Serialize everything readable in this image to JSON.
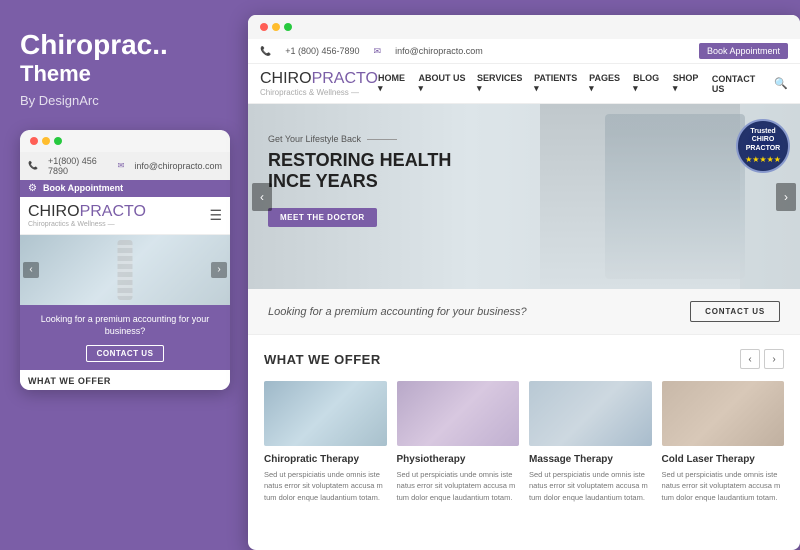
{
  "theme": {
    "title": "Chiroprac..",
    "subtitle": "Theme",
    "author": "By DesignArc"
  },
  "mobile": {
    "top_bar_dots": [
      "red",
      "yellow",
      "green"
    ],
    "info_bar": {
      "phone": "+1(800) 456 7890",
      "email": "info@chiropracto.com"
    },
    "book_btn": "Book Appointment",
    "logo": {
      "chiro": "CHIRO",
      "practo": "PRACTO",
      "sub": "Chiropractics & Wellness —"
    },
    "promo": {
      "text": "Looking for a premium accounting for your business?",
      "btn": "CONTACT US"
    },
    "what_offer_title": "WHAT WE OFFER"
  },
  "desktop": {
    "top_bar_dots": [
      "red",
      "yellow",
      "green"
    ],
    "header": {
      "phone": "+1 (800) 456-7890",
      "email": "info@chiropracto.com",
      "book_btn": "Book Appointment"
    },
    "nav": {
      "logo_chiro": "CHIRO",
      "logo_practo": "PRACTO",
      "logo_sub": "Chiropractics & Wellness —",
      "links": [
        "HOME",
        "ABOUT US",
        "SERVICES",
        "PATIENTS",
        "PAGES",
        "BLOG",
        "SHOP",
        "CONTACT US"
      ]
    },
    "hero": {
      "tagline": "Get Your Lifestyle Back",
      "heading_line1": "RESTORING HEALTH",
      "heading_line2": "INCE YEARS",
      "btn": "MEET THE DOCTOR",
      "badge_text": "Trusted\nCHIROPRACTOR",
      "badge_stars": "★★★★★"
    },
    "promo": {
      "text": "Looking for a premium accounting for your business?",
      "btn": "CONTACT US"
    },
    "what_offer": {
      "title": "WHAT WE OFFER",
      "nav_prev": "‹",
      "nav_next": "›",
      "services": [
        {
          "title": "Chiropratic Therapy",
          "text": "Sed ut perspiciatis unde omnis iste natus error sit voluptatem accusa m tum dolor enque laudantium totam."
        },
        {
          "title": "Physiotherapy",
          "text": "Sed ut perspiciatis unde omnis iste natus error sit voluptatem accusa m tum dolor enque laudantium totam."
        },
        {
          "title": "Massage Therapy",
          "text": "Sed ut perspiciatis unde omnis iste natus error sit voluptatem accusa m tum dolor enque laudantium totam."
        },
        {
          "title": "Cold Laser Therapy",
          "text": "Sed ut perspiciatis unde omnis iste natus error sit voluptatem accusa m tum dolor enque laudantium totam."
        }
      ]
    }
  }
}
